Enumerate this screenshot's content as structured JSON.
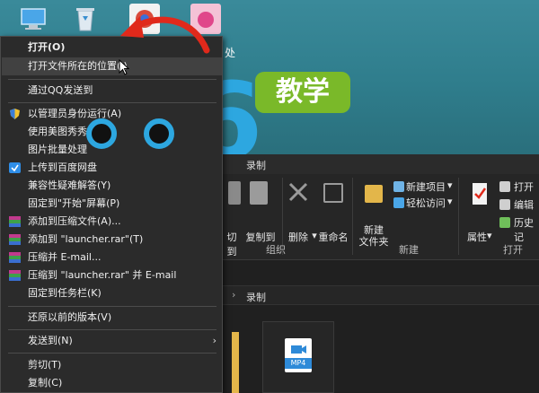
{
  "desktop": {
    "partial_label": "处"
  },
  "watermark": {
    "brand": "pc6",
    "badge": "教学"
  },
  "explorer": {
    "title": "录制",
    "ribbon": {
      "cut_partial": "切到",
      "copy_to": "复制到",
      "delete": "删除",
      "rename": "重命名",
      "new_folder": "新建\n文件夹",
      "new_item": "新建项目",
      "easy_access": "轻松访问",
      "properties": "属性",
      "open": "打开",
      "edit": "编辑",
      "history": "历史记",
      "group_organize": "组织",
      "group_new": "新建",
      "group_open": "打开"
    },
    "address": "录制",
    "file_badge": "MP4"
  },
  "menu": {
    "items": [
      {
        "label": "打开(O)",
        "bold": true
      },
      {
        "label": "打开文件所在的位置(I)",
        "highlight": true
      },
      {
        "label": "通过QQ发送到"
      },
      {
        "label": "以管理员身份运行(A)"
      },
      {
        "label": "使用美图秀秀编辑"
      },
      {
        "label": "图片批量处理"
      },
      {
        "label": "上传到百度网盘"
      },
      {
        "label": "兼容性疑难解答(Y)"
      },
      {
        "label": "固定到\"开始\"屏幕(P)"
      },
      {
        "label": "添加到压缩文件(A)..."
      },
      {
        "label": "添加到 \"launcher.rar\"(T)"
      },
      {
        "label": "压缩并 E-mail..."
      },
      {
        "label": "压缩到 \"launcher.rar\" 并 E-mail"
      },
      {
        "label": "固定到任务栏(K)"
      },
      {
        "label": "还原以前的版本(V)"
      },
      {
        "label": "发送到(N)",
        "submenu": true
      },
      {
        "label": "剪切(T)"
      },
      {
        "label": "复制(C)"
      }
    ]
  },
  "colors": {
    "menu_bg": "#2b2b2b",
    "menu_highlight": "#414141",
    "watermark_blue": "#2da7e0",
    "watermark_green": "#7ab929",
    "arrow_red": "#e0291b"
  }
}
